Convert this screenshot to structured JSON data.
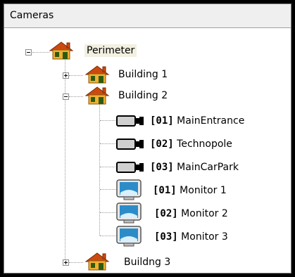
{
  "panel": {
    "title": "Cameras"
  },
  "tree": {
    "root": {
      "label": "Perimeter",
      "toggle": "collapse",
      "icon": "house-icon"
    },
    "buildings": [
      {
        "label": "Building 1",
        "toggle": "expand",
        "icon": "house-icon"
      },
      {
        "label": "Building 2",
        "toggle": "collapse",
        "icon": "house-icon"
      },
      {
        "label": "Buildng 3",
        "toggle": "expand",
        "icon": "house-icon"
      }
    ],
    "devices": [
      {
        "code": "[01]",
        "name": "MainEntrance",
        "icon": "camera-icon"
      },
      {
        "code": "[02]",
        "name": "Technopole",
        "icon": "camera-icon"
      },
      {
        "code": "[03]",
        "name": "MainCarPark",
        "icon": "camera-icon"
      },
      {
        "code": "[01]",
        "name": "Monitor 1",
        "icon": "monitor-icon"
      },
      {
        "code": "[02]",
        "name": "Monitor 2",
        "icon": "monitor-icon"
      },
      {
        "code": "[03]",
        "name": "Monitor 3",
        "icon": "monitor-icon"
      }
    ]
  },
  "colors": {
    "roof": "#cc4a10",
    "wall": "#f0b030",
    "window": "#2e5a10",
    "camera_body": "#d0d0d0",
    "monitor_screen": "#2c8cc8"
  }
}
